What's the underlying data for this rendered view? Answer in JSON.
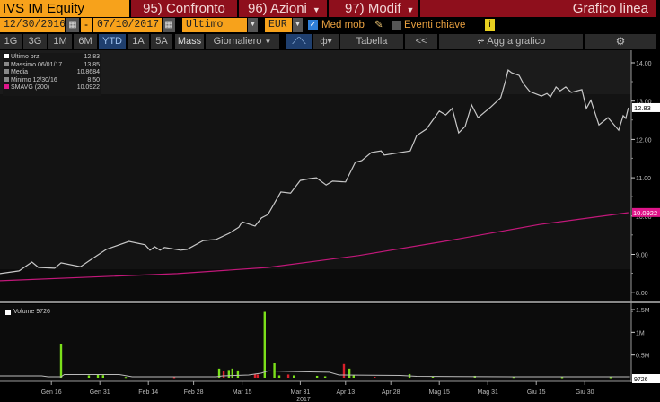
{
  "header": {
    "security": "IVS IM Equity",
    "confronto": "95) Confronto",
    "azioni": "96) Azioni",
    "modif": "97) Modif",
    "chart_type": "Grafico linea"
  },
  "controls": {
    "start_date": "12/30/2016",
    "date_sep": "-",
    "end_date": "07/10/2017",
    "field": "Ultimo prz",
    "currency": "EUR",
    "med_mob": "Med mob",
    "eventi": "Eventi chiave",
    "info": "i"
  },
  "periods": [
    "1G",
    "3G",
    "1M",
    "6M",
    "YTD",
    "1A",
    "5A"
  ],
  "toolbar": {
    "mass": "Mass",
    "freq": "Giornaliero",
    "tabella": "Tabella",
    "back": "<<",
    "add": "Agg a grafico"
  },
  "legend": [
    {
      "label": "Ultimo prz",
      "value": "12.83"
    },
    {
      "label": "Massimo 06/01/17",
      "value": "13.85"
    },
    {
      "label": "Media",
      "value": "10.8684"
    },
    {
      "label": "Minimo 12/30/16",
      "value": "8.50"
    },
    {
      "label": "SMAVG (200)",
      "value": "10.0922"
    }
  ],
  "volume_legend": "Volume 9726",
  "chart_data": {
    "type": "line",
    "price": {
      "name": "Ultimo prz",
      "color": "#c8c8c8",
      "last_label": "12.83",
      "points": [
        [
          1,
          8.5
        ],
        [
          7,
          8.57
        ],
        [
          11,
          8.8
        ],
        [
          13,
          8.66
        ],
        [
          18,
          8.64
        ],
        [
          20,
          8.78
        ],
        [
          26,
          8.68
        ],
        [
          29,
          8.85
        ],
        [
          34,
          9.13
        ],
        [
          41,
          9.34
        ],
        [
          46,
          9.25
        ],
        [
          47.5,
          9.11
        ],
        [
          49,
          9.2
        ],
        [
          50.6,
          9.11
        ],
        [
          52,
          9.18
        ],
        [
          57,
          9.11
        ],
        [
          59,
          9.13
        ],
        [
          64,
          9.36
        ],
        [
          68,
          9.39
        ],
        [
          72,
          9.55
        ],
        [
          75,
          9.71
        ],
        [
          76,
          9.85
        ],
        [
          80,
          9.74
        ],
        [
          82,
          9.95
        ],
        [
          84,
          10.04
        ],
        [
          88,
          10.63
        ],
        [
          91,
          10.6
        ],
        [
          94,
          10.93
        ],
        [
          97,
          10.98
        ],
        [
          99,
          11.0
        ],
        [
          102,
          10.81
        ],
        [
          104,
          10.91
        ],
        [
          108,
          10.89
        ],
        [
          111,
          11.4
        ],
        [
          113,
          11.45
        ],
        [
          116,
          11.66
        ],
        [
          119,
          11.7
        ],
        [
          120,
          11.59
        ],
        [
          128,
          11.7
        ],
        [
          130,
          12.1
        ],
        [
          133,
          12.27
        ],
        [
          137,
          12.74
        ],
        [
          139,
          12.64
        ],
        [
          141,
          12.81
        ],
        [
          143,
          12.17
        ],
        [
          145,
          12.34
        ],
        [
          147,
          12.9
        ],
        [
          149,
          12.57
        ],
        [
          153,
          12.85
        ],
        [
          156,
          13.09
        ],
        [
          157.5,
          13.53
        ],
        [
          158.3,
          13.81
        ],
        [
          159.4,
          13.74
        ],
        [
          161.7,
          13.67
        ],
        [
          163,
          13.46
        ],
        [
          165,
          13.25
        ],
        [
          168.6,
          13.13
        ],
        [
          170.3,
          13.2
        ],
        [
          171.4,
          13.11
        ],
        [
          173.1,
          13.37
        ],
        [
          174.4,
          13.27
        ],
        [
          176.1,
          13.37
        ],
        [
          177.8,
          13.23
        ],
        [
          181.1,
          13.3
        ],
        [
          182.5,
          12.81
        ],
        [
          183.9,
          13.02
        ],
        [
          186.4,
          12.38
        ],
        [
          189.2,
          12.57
        ],
        [
          192.5,
          12.24
        ],
        [
          193.9,
          12.62
        ],
        [
          194.7,
          12.55
        ],
        [
          195.5,
          12.83
        ]
      ]
    },
    "smavg": {
      "name": "SMAVG (200)",
      "color": "#c2187a",
      "last_label": "10.0922",
      "points": [
        [
          0,
          8.31
        ],
        [
          56,
          8.5
        ],
        [
          84,
          8.66
        ],
        [
          112,
          8.97
        ],
        [
          140,
          9.36
        ],
        [
          168,
          9.78
        ],
        [
          195.5,
          10.09
        ]
      ]
    },
    "y_ticks": [
      "8.00",
      "9.00",
      "10.00",
      "11.00",
      "12.00",
      "13.00",
      "14.00"
    ],
    "ylim": [
      8,
      14
    ],
    "x_ticks": [
      {
        "label": "Gen 16",
        "day": 17
      },
      {
        "label": "Gen 31",
        "day": 32
      },
      {
        "label": "Feb 14",
        "day": 47
      },
      {
        "label": "Feb 28",
        "day": 61
      },
      {
        "label": "Mar 15",
        "day": 76
      },
      {
        "label": "Mar 31",
        "day": 94
      },
      {
        "label": "Apr 13",
        "day": 108
      },
      {
        "label": "Apr 28",
        "day": 122
      },
      {
        "label": "Mag 15",
        "day": 137
      },
      {
        "label": "Mag 31",
        "day": 152
      },
      {
        "label": "Giu 15",
        "day": 167
      },
      {
        "label": "Giu 30",
        "day": 182
      }
    ],
    "x_year": "2017",
    "volume": {
      "last_label": "9726",
      "y_ticks": [
        {
          "label": "0.5M",
          "v": 500000
        },
        {
          "label": "1M",
          "v": 1000000
        },
        {
          "label": "1.5M",
          "v": 1500000
        }
      ],
      "bars": [
        [
          20,
          750000,
          "up"
        ],
        [
          28.6,
          50000,
          "up"
        ],
        [
          31.4,
          60000,
          "up"
        ],
        [
          33,
          55000,
          "up"
        ],
        [
          68.9,
          200000,
          "up"
        ],
        [
          70.3,
          150000,
          "down"
        ],
        [
          71.9,
          170000,
          "up"
        ],
        [
          73,
          200000,
          "up"
        ],
        [
          74.7,
          160000,
          "up"
        ],
        [
          80,
          80000,
          "down"
        ],
        [
          80.8,
          70000,
          "down"
        ],
        [
          83,
          1450000,
          "up"
        ],
        [
          86,
          330000,
          "up"
        ],
        [
          87.5,
          50000,
          "up"
        ],
        [
          90.3,
          70000,
          "down"
        ],
        [
          92,
          50000,
          "up"
        ],
        [
          99.2,
          40000,
          "up"
        ],
        [
          101.7,
          30000,
          "up"
        ],
        [
          107.5,
          300000,
          "down"
        ],
        [
          109.2,
          200000,
          "up"
        ],
        [
          110.5,
          50000,
          "up"
        ],
        [
          127.8,
          80000,
          "up"
        ],
        [
          148,
          40000,
          "up"
        ],
        [
          40,
          15000,
          "up"
        ],
        [
          55,
          10000,
          "down"
        ],
        [
          117,
          20000,
          "down"
        ],
        [
          135,
          20000,
          "up"
        ],
        [
          160,
          15000,
          "up"
        ],
        [
          175,
          10000,
          "up"
        ],
        [
          190,
          10000,
          "up"
        ]
      ],
      "avg": [
        [
          0,
          40000
        ],
        [
          14,
          40000
        ],
        [
          16,
          20000
        ],
        [
          20,
          20000
        ],
        [
          21,
          70000
        ],
        [
          38,
          70000
        ],
        [
          42,
          20000
        ],
        [
          68,
          20000
        ],
        [
          70,
          40000
        ],
        [
          78,
          60000
        ],
        [
          82,
          100000
        ],
        [
          84,
          150000
        ],
        [
          95,
          130000
        ],
        [
          103,
          120000
        ],
        [
          106,
          60000
        ],
        [
          125,
          50000
        ],
        [
          130,
          30000
        ],
        [
          160,
          20000
        ],
        [
          196,
          20000
        ]
      ]
    }
  }
}
